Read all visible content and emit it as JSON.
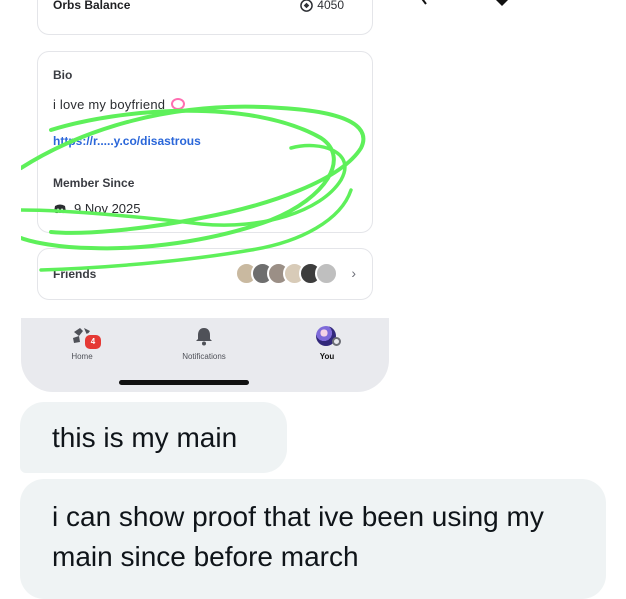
{
  "profile_screenshot": {
    "orbs": {
      "label": "Orbs Balance",
      "value": "4050"
    },
    "bio": {
      "title": "Bio",
      "text": "i love my boyfriend",
      "link": "https://r.....y.co/disastrous"
    },
    "member_since": {
      "title": "Member Since",
      "date": "9 Nov 2025"
    },
    "friends": {
      "title": "Friends",
      "count": 6
    },
    "tabbar": {
      "home_label": "Home",
      "home_badge": "4",
      "notifications_label": "Notifications",
      "you_label": "You"
    },
    "colors": {
      "link": "#2a66d9",
      "scribble": "#5ef05a",
      "badge": "#e53935"
    }
  },
  "messages": [
    {
      "text": "this is my main"
    },
    {
      "text": "i can show proof that ive been using my main since before march"
    }
  ]
}
